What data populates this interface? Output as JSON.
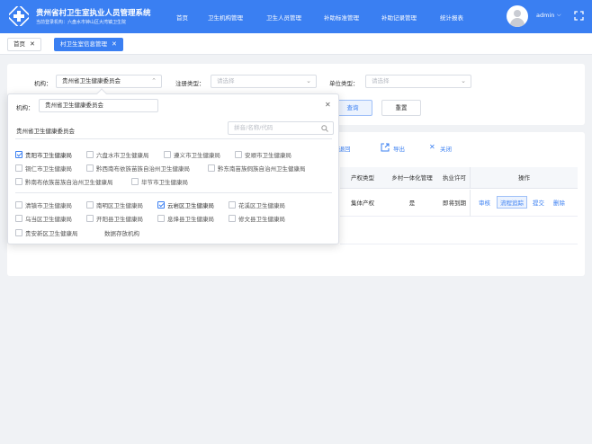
{
  "header": {
    "title": "贵州省村卫生室执业人员管理系统",
    "subtitle": "当前登录机构：六盘水市钟山区大湾镇卫生院",
    "nav": [
      "首页",
      "卫生机构管理",
      "卫生人员管理",
      "补助标准管理",
      "补助记录管理",
      "统计报表"
    ],
    "username": "admin"
  },
  "tabs": [
    {
      "label": "首页",
      "close": "✕"
    },
    {
      "label": "村卫生室信息管理",
      "close": "✕"
    }
  ],
  "search": {
    "org_label": "机构：",
    "org_value": "贵州省卫生健康委员会",
    "reg_label": "注册类型：",
    "reg_placeholder": "请选择",
    "unit_label": "单位类型：",
    "unit_placeholder": "请选择",
    "query_btn": "查询",
    "reset_btn": "重置"
  },
  "toolbar": {
    "back_btn": "撤退回",
    "export_btn": "导出",
    "close_btn": "关闭"
  },
  "table": {
    "headers": [
      "产权类型",
      "乡村一体化管理",
      "执业许可",
      "操作"
    ],
    "row": {
      "property": "集体产权",
      "integrated": "是",
      "license": "即将到期",
      "actions": [
        "审核",
        "流程追踪",
        "提交",
        "删除"
      ]
    }
  },
  "popover": {
    "org_label": "机构：",
    "org_value": "贵州省卫生健康委员会",
    "section_title": "贵州省卫生健康委员会",
    "search_placeholder": "拼音/名称/代码",
    "close": "✕",
    "cities": [
      {
        "label": "贵阳市卫生健康局",
        "checked": true
      },
      {
        "label": "六盘水市卫生健康局",
        "checked": false
      },
      {
        "label": "遵义市卫生健康局",
        "checked": false
      },
      {
        "label": "安顺市卫生健康局",
        "checked": false
      },
      {
        "label": "铜仁市卫生健康局",
        "checked": false
      },
      {
        "label": "黔西南布依族苗族自治州卫生健康局",
        "checked": false
      },
      {
        "label": "黔东南苗族侗族自治州卫生健康局",
        "checked": false
      },
      {
        "label": "黔南布依族苗族自治州卫生健康局",
        "checked": false
      },
      {
        "label": "毕节市卫生健康局",
        "checked": false
      }
    ],
    "districts": [
      {
        "label": "清镇市卫生健康局",
        "checked": false
      },
      {
        "label": "南明区卫生健康局",
        "checked": false
      },
      {
        "label": "云岩区卫生健康局",
        "checked": true
      },
      {
        "label": "花溪区卫生健康局",
        "checked": false
      },
      {
        "label": "乌当区卫生健康局",
        "checked": false
      },
      {
        "label": "开阳县卫生健康局",
        "checked": false
      },
      {
        "label": "息烽县卫生健康局",
        "checked": false
      },
      {
        "label": "修文县卫生健康局",
        "checked": false
      },
      {
        "label": "贵安新区卫生健康局",
        "checked": false
      },
      {
        "label": "数据存放机构",
        "checked": null
      }
    ]
  },
  "colors": {
    "primary": "#3a7ff2",
    "background": "#f0f2f5"
  },
  "icons": {
    "logo": "cross-logo-icon",
    "fullscreen": "fullscreen-icon",
    "search": "search-icon",
    "export": "export-icon",
    "close": "close-icon"
  }
}
